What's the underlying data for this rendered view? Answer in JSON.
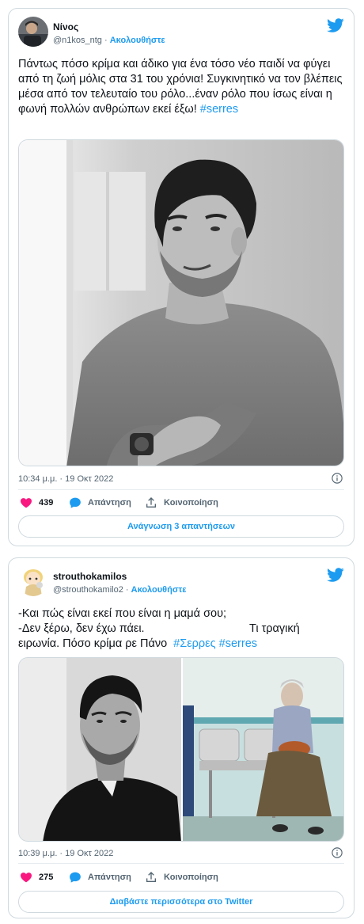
{
  "tweets": [
    {
      "author_name": "Νίνος",
      "handle": "@n1kos_ntg",
      "separator": "·",
      "follow_label": "Ακολουθήστε",
      "text": "Πάντως πόσο κρίμα και άδικο για ένα τόσο νέο παιδί να φύγει από τη ζωή μόλις στα 31 του χρόνια! Συγκινητικό να τον βλέπεις μέσα από τον τελευταίο του ρόλο...έναν ρόλο που ίσως είναι η φωνή πολλών ανθρώπων εκεί έξω!",
      "hashtag": "#serres",
      "timestamp": "10:34 μ.μ. · 19 Οκτ 2022",
      "likes": "439",
      "reply_label": "Απάντηση",
      "share_label": "Κοινοποίηση",
      "cta_label": "Ανάγνωση 3 απαντήσεων"
    },
    {
      "author_name": "strouthokamilos",
      "handle": "@strouthokamilo2",
      "separator": "·",
      "follow_label": "Ακολουθήστε",
      "text_line1": "-Και πώς είναι εκεί που είναι η μαμά σου;",
      "text_line2a": "-Δεν ξέρω, δεν έχω πάει.",
      "text_line2b": "Τι τραγική",
      "text_line3": "ειρωνία. Πόσο κρίμα ρε Πάνο",
      "hashtag1": "#Σερρες",
      "hashtag2": "#serres",
      "timestamp": "10:39 μ.μ. · 19 Οκτ 2022",
      "likes": "275",
      "reply_label": "Απάντηση",
      "share_label": "Κοινοποίηση",
      "cta_label": "Διαβάστε περισσότερα στο Twitter"
    }
  ],
  "colors": {
    "accent": "#1d9bf0",
    "like": "#f91880",
    "muted": "#536471",
    "border": "#cfd9de"
  },
  "icons": [
    "twitter-bird-icon",
    "heart-icon",
    "reply-bubble-icon",
    "share-upload-icon",
    "info-icon"
  ]
}
